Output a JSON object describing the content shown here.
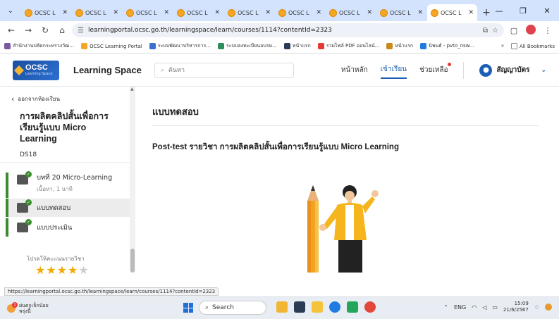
{
  "browser": {
    "tabs": [
      {
        "title": "OCSC L",
        "active": false
      },
      {
        "title": "OCSC L",
        "active": false
      },
      {
        "title": "OCSC L",
        "active": false
      },
      {
        "title": "OCSC L",
        "active": false
      },
      {
        "title": "OCSC L",
        "active": false
      },
      {
        "title": "OCSC L",
        "active": false
      },
      {
        "title": "OCSC L",
        "active": false
      },
      {
        "title": "OCSC L",
        "active": false
      },
      {
        "title": "OCSC L",
        "active": true
      }
    ],
    "url": "learningportal.ocsc.go.th/learningspace/learn/courses/1114?contentId=2323",
    "bookmarks": [
      "สำนักงานปลัดกระทรวงวัฒ...",
      "OCSC Learning Portal",
      "ระบบพัฒนาบริหารการ...",
      "ระบบลงทะเบียนอบรม...",
      "หน้าแรก",
      "รวมไฟล์ PDF ออนไลน์...",
      "หน้าแรก",
      "นิพนธ์ - pvto_nsw..."
    ],
    "all_bookmarks": "All Bookmarks",
    "status_url": "https://learningportal.ocsc.go.th/learningspace/learn/courses/1114?contentId=2323"
  },
  "app": {
    "logo_text": "OCSC",
    "logo_sub": "Learning Space",
    "title": "Learning Space",
    "search_placeholder": "ค้นหา",
    "nav": [
      "หน้าหลัก",
      "เข้าเรียน",
      "ช่วยเหลือ"
    ],
    "nav_active": "เข้าเรียน",
    "user_name": "สัญญาบัตร"
  },
  "sidebar": {
    "back_label": "ออกจากห้องเรียน",
    "course_title": "การผลิตคลิปสั้นเพื่อการเรียนรู้แบบ Micro Learning",
    "course_code": "DS18",
    "items": [
      {
        "label": "บทที่ 20 Micro-Learning",
        "sub": "เนื้อหา, 1 นาที",
        "icon": "video-lesson-icon"
      },
      {
        "label": "แบบทดสอบ",
        "sub": "",
        "icon": "quiz-icon"
      },
      {
        "label": "แบบประเมิน",
        "sub": "",
        "icon": "evaluation-icon"
      }
    ],
    "rating_label": "โปรดให้คะแนนรายวิชา",
    "rating": 4,
    "rating_max": 5
  },
  "main": {
    "section_title": "แบบทดสอบ",
    "test_title": "Post-test รายวิชา การผลิตคลิปสั้นเพื่อการเรียนรู้แบบ Micro Learning"
  },
  "taskbar": {
    "weather_line1": "ฝนตกเล็กน้อย",
    "weather_line2": "พรุ่งนี้",
    "search_label": "Search",
    "lang": "ENG",
    "time": "15:09",
    "date": "21/6/2567"
  },
  "colors": {
    "accent": "#1a5fb4",
    "complete": "#3b8c2e",
    "star": "#f2a900"
  }
}
